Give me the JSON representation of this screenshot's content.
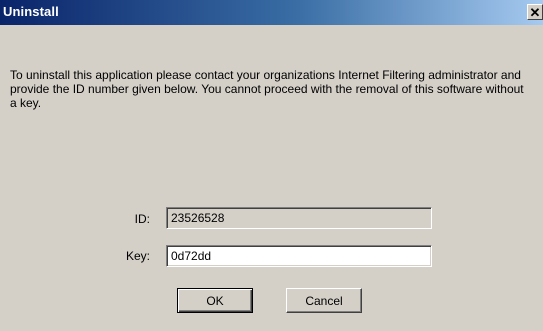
{
  "window": {
    "title": "Uninstall",
    "close_glyph": "✕"
  },
  "message": "To uninstall this application please contact your organizations Internet Filtering administrator and provide the ID number given below. You cannot proceed with the removal of this software without a key.",
  "fields": {
    "id": {
      "label": "ID:",
      "value": "23526528"
    },
    "key": {
      "label": "Key:",
      "value": "0d72dd"
    }
  },
  "buttons": {
    "ok_label": "OK",
    "cancel_label": "Cancel"
  },
  "colors": {
    "face": "#d4d0c8",
    "title_start": "#0a246a",
    "title_end": "#a6caf0"
  }
}
